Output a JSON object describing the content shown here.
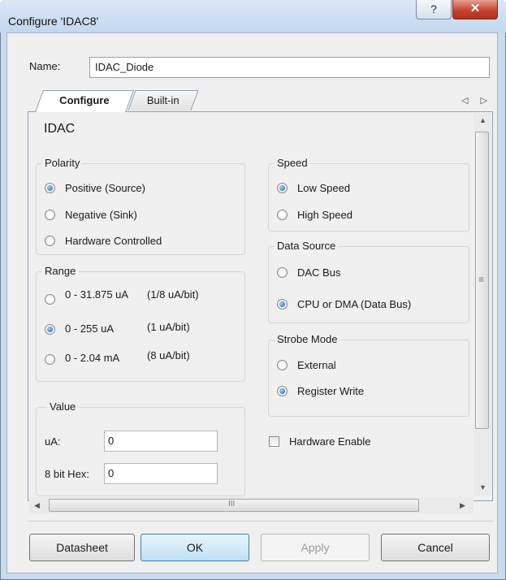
{
  "window": {
    "title": "Configure 'IDAC8'",
    "help_glyph": "?",
    "close_glyph": "✕"
  },
  "name": {
    "label": "Name:",
    "value": "IDAC_Diode"
  },
  "tabs": [
    {
      "label": "Configure",
      "active": true
    },
    {
      "label": "Built-in",
      "active": false
    }
  ],
  "tab_arrows": "◁ ▷",
  "panel": {
    "title": "IDAC"
  },
  "polarity": {
    "label": "Polarity",
    "options": [
      {
        "label": "Positive (Source)",
        "selected": true
      },
      {
        "label": "Negative (Sink)",
        "selected": false
      },
      {
        "label": "Hardware Controlled",
        "selected": false
      }
    ]
  },
  "range": {
    "label": "Range",
    "options": [
      {
        "label": "0 - 31.875 uA",
        "note": "(1/8 uA/bit)",
        "selected": false
      },
      {
        "label": "0 - 255 uA",
        "note": "(1 uA/bit)",
        "selected": true
      },
      {
        "label": "0 - 2.04 mA",
        "note": "(8 uA/bit)",
        "selected": false
      }
    ]
  },
  "value": {
    "label": "Value",
    "ua_label": "uA:",
    "ua_value": "0",
    "hex_label": "8 bit Hex:",
    "hex_value": "0"
  },
  "speed": {
    "label": "Speed",
    "options": [
      {
        "label": "Low Speed",
        "selected": true
      },
      {
        "label": "High Speed",
        "selected": false
      }
    ]
  },
  "data_source": {
    "label": "Data Source",
    "options": [
      {
        "label": "DAC Bus",
        "selected": false
      },
      {
        "label": "CPU or DMA (Data Bus)",
        "selected": true
      }
    ]
  },
  "strobe_mode": {
    "label": "Strobe Mode",
    "options": [
      {
        "label": "External",
        "selected": false
      },
      {
        "label": "Register Write",
        "selected": true
      }
    ]
  },
  "hardware_enable": {
    "label": "Hardware Enable",
    "checked": false
  },
  "scroll": {
    "up": "▲",
    "down": "▼",
    "left": "◀",
    "right": "▶",
    "grip_v": "≡",
    "grip_h": "III"
  },
  "buttons": {
    "datasheet": "Datasheet",
    "ok": "OK",
    "apply": "Apply",
    "cancel": "Cancel"
  }
}
